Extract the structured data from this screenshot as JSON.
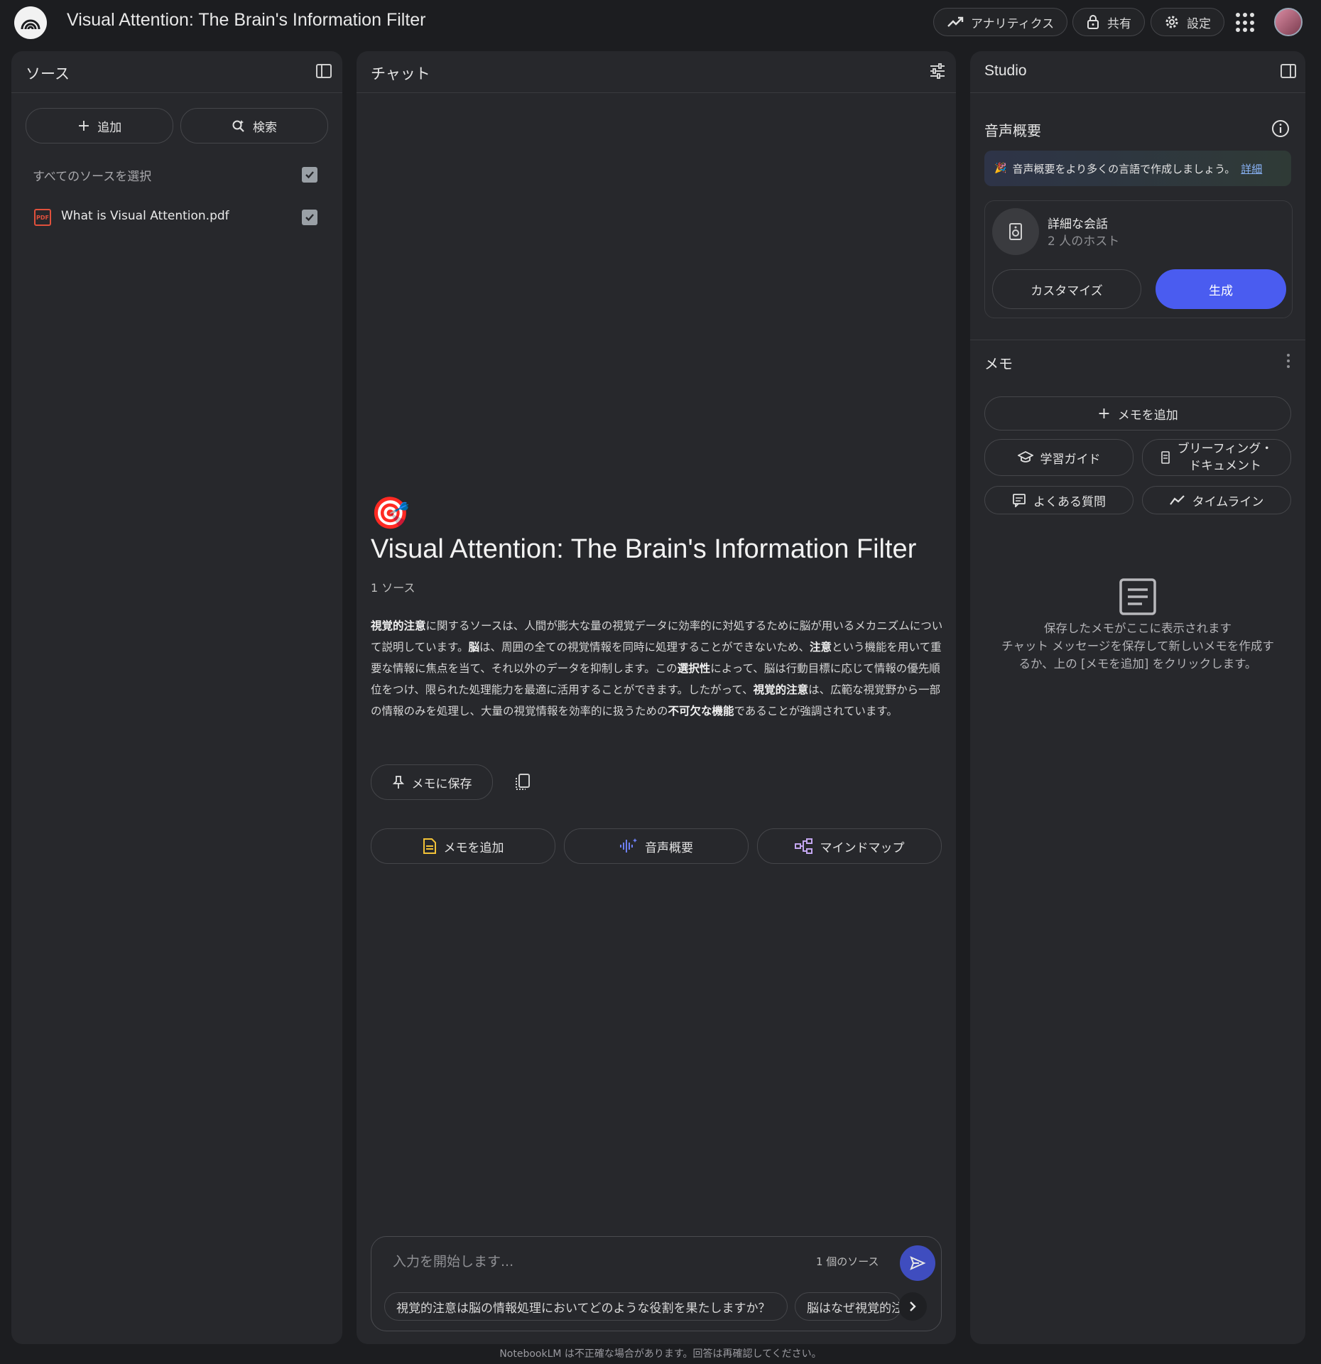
{
  "app": {
    "title": "Visual Attention: The Brain's Information Filter"
  },
  "header": {
    "analytics_label": "アナリティクス",
    "share_label": "共有",
    "settings_label": "設定"
  },
  "sources": {
    "title": "ソース",
    "add_label": "追加",
    "search_label": "検索",
    "select_all_label": "すべてのソースを選択",
    "items": [
      {
        "name": "What is Visual Attention.pdf",
        "checked": true
      }
    ]
  },
  "chat": {
    "title": "チャット",
    "emoji": "🎯",
    "notebook_title": "Visual Attention: The Brain's Information Filter",
    "source_count": "1 ソース",
    "summary_segments": [
      {
        "text": "視覚的注意",
        "bold": true
      },
      {
        "text": "に関するソースは、人間が膨大な量の視覚データに効率的に対処するために脳が用いるメカニズムについて説明しています。",
        "bold": false
      },
      {
        "text": "脳",
        "bold": true
      },
      {
        "text": "は、周囲の全ての視覚情報を同時に処理することができないため、",
        "bold": false
      },
      {
        "text": "注意",
        "bold": true
      },
      {
        "text": "という機能を用いて重要な情報に焦点を当て、それ以外のデータを抑制します。この",
        "bold": false
      },
      {
        "text": "選択性",
        "bold": true
      },
      {
        "text": "によって、脳は行動目標に応じて情報の優先順位をつけ、限られた処理能力を最適に活用することができます。したがって、",
        "bold": false
      },
      {
        "text": "視覚的注意",
        "bold": true
      },
      {
        "text": "は、広範な視覚野から一部の情報のみを処理し、大量の視覚情報を効率的に扱うための",
        "bold": false
      },
      {
        "text": "不可欠な機能",
        "bold": true
      },
      {
        "text": "であることが強調されています。",
        "bold": false
      }
    ],
    "save_to_note_label": "メモに保存",
    "actions": {
      "add_note": "メモを追加",
      "audio_overview": "音声概要",
      "mind_map": "マインドマップ"
    },
    "input_placeholder": "入力を開始します...",
    "input_source_count": "1 個のソース",
    "suggestions": [
      "視覚的注意は脳の情報処理においてどのような役割を果たしますか？",
      "脳はなぜ視覚的注"
    ]
  },
  "studio": {
    "title": "Studio",
    "audio_overview_title": "音声概要",
    "banner_text": "音声概要をより多くの言語で作成しましょう。",
    "banner_link": "詳細",
    "conversation_title": "詳細な会話",
    "conversation_hosts": "2 人のホスト",
    "customize_label": "カスタマイズ",
    "generate_label": "生成",
    "notes_title": "メモ",
    "add_note_label": "メモを追加",
    "study_guide_label": "学習ガイド",
    "briefing_label_1": "ブリーフィング・",
    "briefing_label_2": "ドキュメント",
    "faq_label": "よくある質問",
    "timeline_label": "タイムライン",
    "empty_line1": "保存したメモがここに表示されます",
    "empty_line2": "チャット メッセージを保存して新しいメモを作成す",
    "empty_line3": "るか、上の [メモを追加] をクリックします。"
  },
  "footer": {
    "disclaimer": "NotebookLM は不正確な場合があります。回答は再確認してください。"
  },
  "colors": {
    "background": "#1c1d20",
    "panel": "#27282c",
    "accent_blue": "#4a5cf0",
    "send_button": "#3f4dbf",
    "pdf_red": "#e0503c"
  }
}
